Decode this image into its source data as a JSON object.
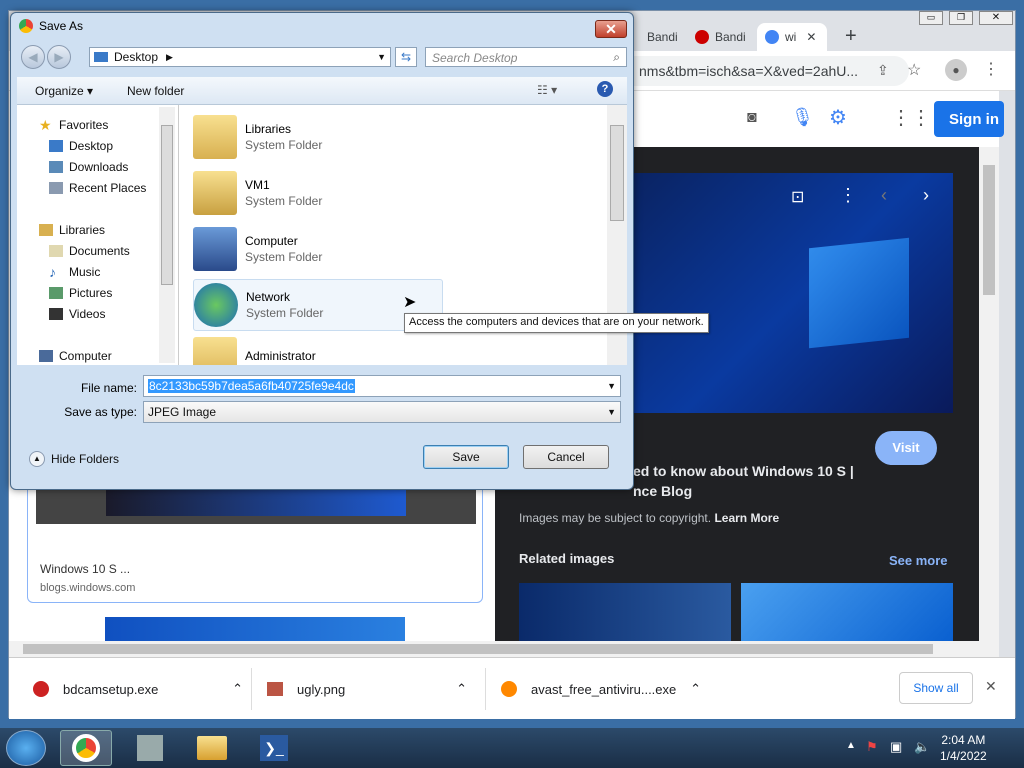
{
  "browser": {
    "tabs": [
      {
        "label": "Bandi",
        "color": "#d33"
      },
      {
        "label": "Bandi",
        "color": "#c00"
      },
      {
        "label": "wi",
        "color": "#4285f4"
      }
    ],
    "new_tab": "+",
    "url": "nms&tbm=isch&sa=X&ved=2ahU...",
    "sign_in": "Sign in"
  },
  "results": {
    "card_title": "Windows 10 S ...",
    "card_source": "blogs.windows.com"
  },
  "preview": {
    "visit": "Visit",
    "title_line1": "ed to know about Windows 10 S |",
    "title_line2": "nce Blog",
    "copyright": "Images may be subject to copyright.",
    "learn_more": "Learn More",
    "related": "Related images",
    "see_more": "See more"
  },
  "downloads": {
    "items": [
      {
        "name": "bdcamsetup.exe"
      },
      {
        "name": "ugly.png"
      },
      {
        "name": "avast_free_antiviru....exe"
      }
    ],
    "show_all": "Show all",
    "close": "✕"
  },
  "dialog": {
    "title": "Save As",
    "address": "Desktop",
    "search_placeholder": "Search Desktop",
    "organize": "Organize ▾",
    "new_folder": "New folder",
    "nav": {
      "favorites": "Favorites",
      "favorite_items": [
        "Desktop",
        "Downloads",
        "Recent Places"
      ],
      "libraries": "Libraries",
      "library_items": [
        "Documents",
        "Music",
        "Pictures",
        "Videos"
      ],
      "computer": "Computer"
    },
    "files": [
      {
        "name": "Libraries",
        "type": "System Folder"
      },
      {
        "name": "VM1",
        "type": "System Folder"
      },
      {
        "name": "Computer",
        "type": "System Folder"
      },
      {
        "name": "Network",
        "type": "System Folder"
      },
      {
        "name": "Administrator",
        "type": ""
      }
    ],
    "tooltip": "Access the computers and devices that are on your network.",
    "file_name_label": "File name:",
    "file_name_value": "8c2133bc59b7dea5a6fb40725fe9e4dc",
    "save_type_label": "Save as type:",
    "save_type_value": "JPEG Image",
    "hide_folders": "Hide Folders",
    "save": "Save",
    "cancel": "Cancel"
  },
  "taskbar": {
    "time": "2:04 AM",
    "date": "1/4/2022"
  }
}
